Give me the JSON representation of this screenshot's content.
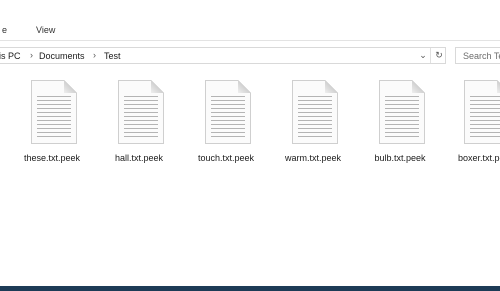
{
  "ribbon": {
    "tabs": [
      "e",
      "View"
    ]
  },
  "address_bar": {
    "crumbs": [
      "is PC",
      "Documents",
      "Test"
    ]
  },
  "search": {
    "placeholder": "Search Te"
  },
  "files": [
    {
      "name": "these.txt.peek",
      "icon": "text-file-icon"
    },
    {
      "name": "hall.txt.peek",
      "icon": "text-file-icon"
    },
    {
      "name": "touch.txt.peek",
      "icon": "text-file-icon"
    },
    {
      "name": "warm.txt.peek",
      "icon": "text-file-icon"
    },
    {
      "name": "bulb.txt.peek",
      "icon": "text-file-icon"
    },
    {
      "name": "boxer.txt.pe",
      "icon": "text-file-icon"
    }
  ],
  "colors": {
    "taskbar": "#1d3b56"
  }
}
